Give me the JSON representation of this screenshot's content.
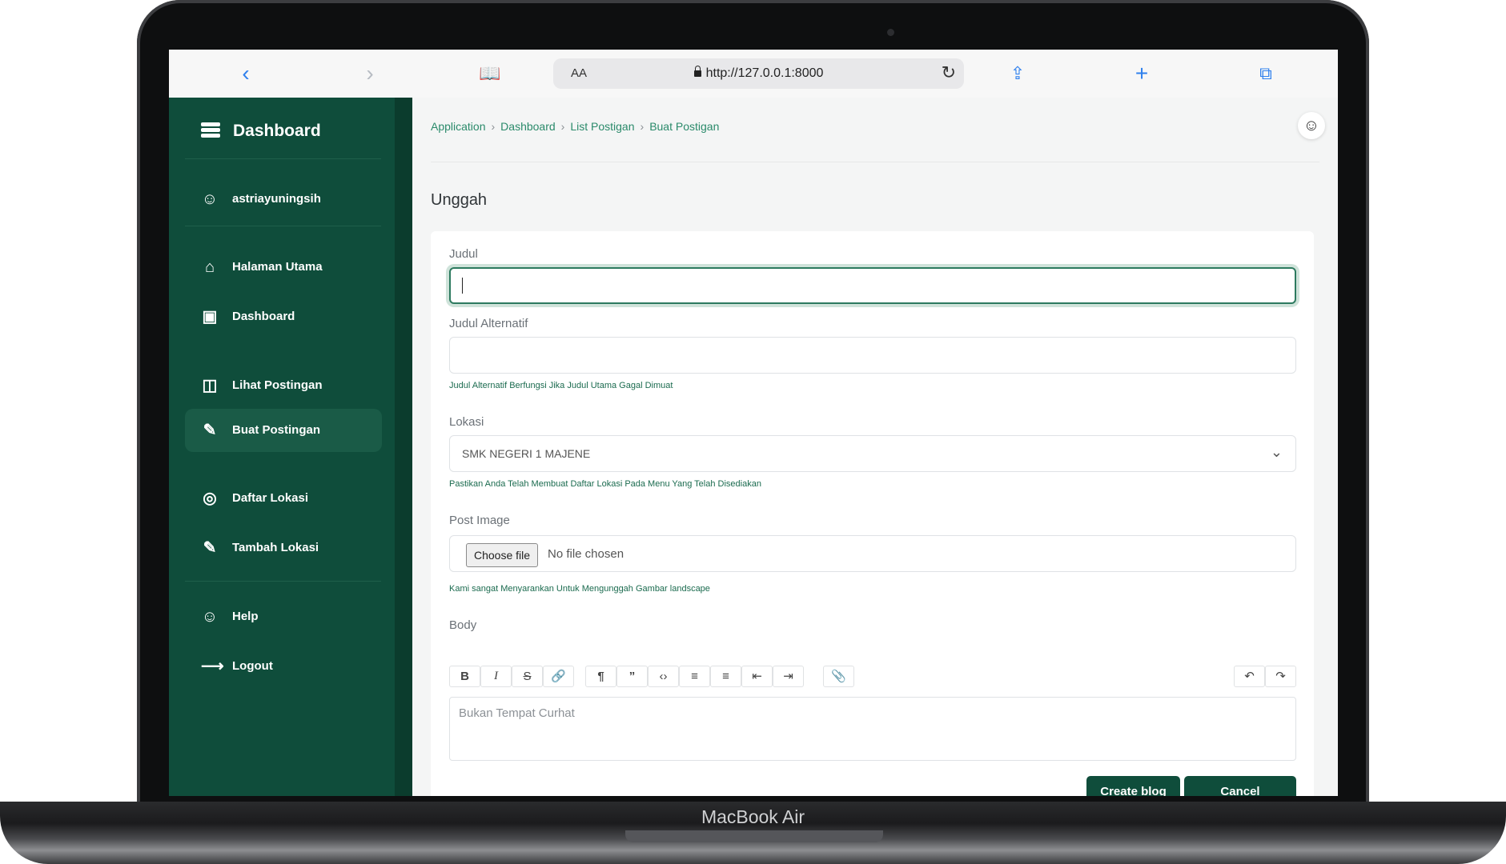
{
  "device_label": "MacBook Air",
  "browser": {
    "text_size_label": "AA",
    "url": "http://127.0.0.1:8000",
    "icons": [
      "back-icon",
      "forward-icon",
      "bookmarks-icon",
      "reload-icon",
      "share-icon",
      "new-tab-icon",
      "tabs-icon"
    ]
  },
  "sidebar": {
    "brand": "Dashboard",
    "user": "astriayuningsih",
    "items": [
      {
        "label": "Halaman Utama",
        "icon": "home-icon"
      },
      {
        "label": "Dashboard",
        "icon": "inbox-icon"
      },
      {
        "label": "Lihat Postingan",
        "icon": "image-icon"
      },
      {
        "label": "Buat Postingan",
        "icon": "edit-icon",
        "active": true
      },
      {
        "label": "Daftar Lokasi",
        "icon": "location-pin-icon"
      },
      {
        "label": "Tambah Lokasi",
        "icon": "edit-icon"
      },
      {
        "label": "Help",
        "icon": "user-icon"
      },
      {
        "label": "Logout",
        "icon": "logout-icon"
      }
    ]
  },
  "breadcrumb": [
    "Application",
    "Dashboard",
    "List Postigan",
    "Buat Postigan"
  ],
  "page_title": "Unggah",
  "form": {
    "judul_label": "Judul",
    "judul_value": "",
    "judul_alt_label": "Judul Alternatif",
    "judul_alt_hint": "Judul Alternatif Berfungsi Jika Judul Utama Gagal Dimuat",
    "lokasi_label": "Lokasi",
    "lokasi_value": "SMK NEGERI 1 MAJENE",
    "lokasi_hint": "Pastikan Anda Telah Membuat Daftar Lokasi Pada Menu Yang Telah Disediakan",
    "image_label": "Post Image",
    "file_button": "Choose file",
    "file_status": "No file chosen",
    "image_hint": "Kami sangat Menyarankan Untuk Mengunggah Gambar landscape",
    "body_label": "Body",
    "body_placeholder": "Bukan Tempat Curhat",
    "toolbar": [
      "B",
      "I",
      "S",
      "link",
      "heading",
      "quote",
      "code",
      "bullets",
      "numbers",
      "outdent",
      "indent",
      "attach",
      "undo",
      "redo"
    ],
    "submit": "Create blog",
    "cancel": "Cancel"
  },
  "colors": {
    "sidebar": "#0f4d3b",
    "accent": "#2d7a5f",
    "hint": "#1b6b4f"
  }
}
